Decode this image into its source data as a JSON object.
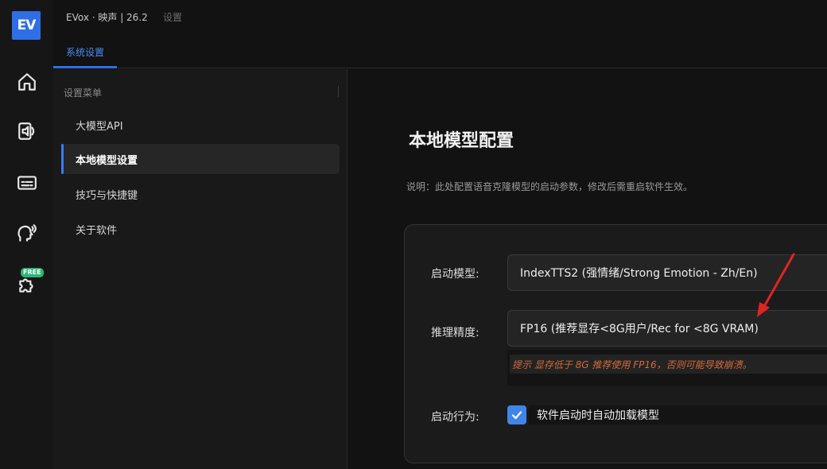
{
  "app": {
    "logo_text": "EV",
    "title": "EVox · 映声 | 26.2",
    "breadcrumb": "设置",
    "accent_color": "#2f6fe6"
  },
  "rail": {
    "items": [
      {
        "icon": "home-icon"
      },
      {
        "icon": "speaker-document-icon"
      },
      {
        "icon": "subtitle-icon"
      },
      {
        "icon": "voice-head-icon"
      },
      {
        "icon": "puzzle-plugin-icon",
        "badge": "FREE"
      }
    ]
  },
  "tabs": {
    "system": "系统设置"
  },
  "submenu": {
    "title": "设置菜单",
    "items": [
      {
        "label": "大模型API"
      },
      {
        "label": "本地模型设置",
        "active": true
      },
      {
        "label": "技巧与快捷键"
      },
      {
        "label": "关于软件"
      }
    ]
  },
  "main": {
    "title": "本地模型配置",
    "description": "说明：此处配置语音克隆模型的启动参数，修改后需重启软件生效。",
    "startup_model": {
      "label": "启动模型:",
      "value": "IndexTTS2 (强情绪/Strong Emotion - Zh/En)"
    },
    "precision": {
      "label": "推理精度:",
      "value": "FP16 (推荐显存<8G用户/Rec for <8G VRAM)",
      "hint": "提示 显存低于 8G 推荐使用 FP16，否则可能导致崩溃。",
      "hint_color": "#d46a3a"
    },
    "startup_behavior": {
      "label": "启动行为:",
      "checkbox_label": "软件启动时自动加载模型",
      "checked": true
    },
    "annotation_color": "#e02424"
  }
}
